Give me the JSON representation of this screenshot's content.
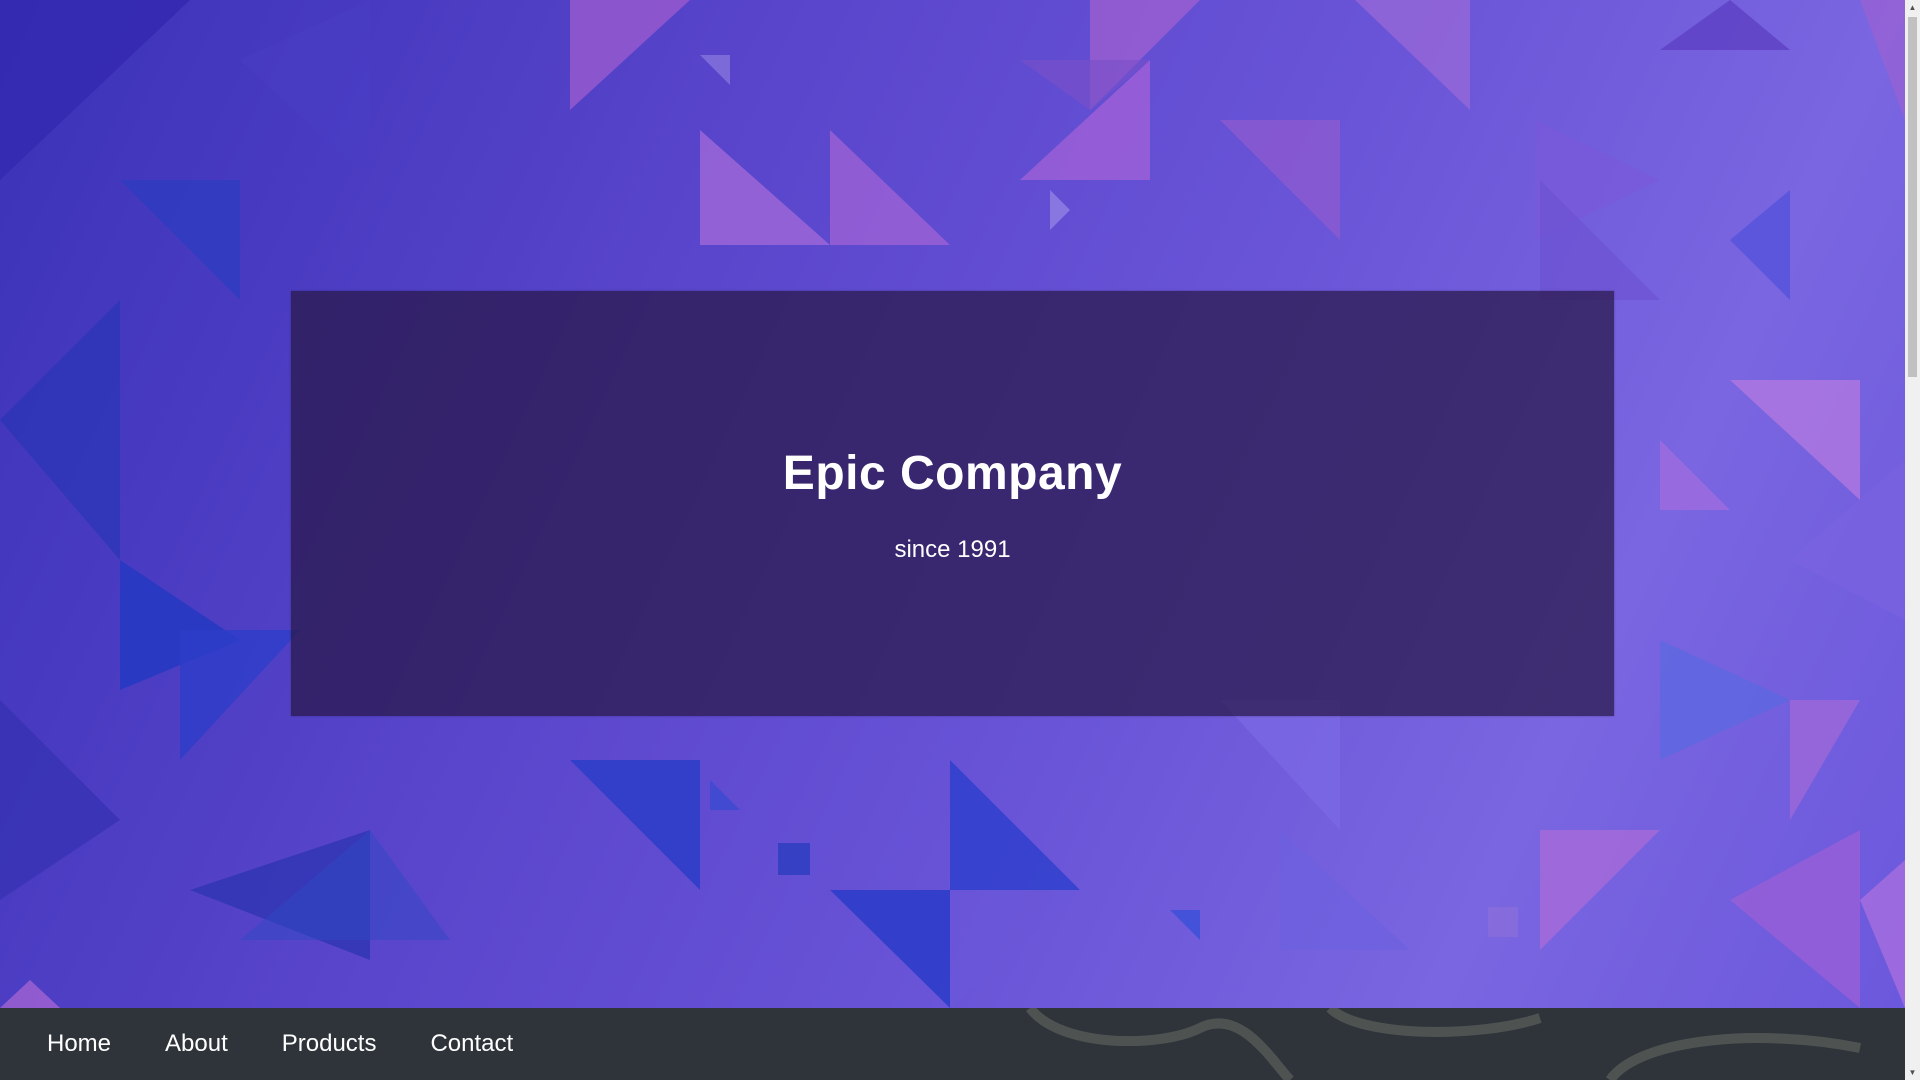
{
  "hero": {
    "title": "Epic Company",
    "subtitle": "since 1991",
    "background_icon": "geometric-triangle-pattern"
  },
  "nav": {
    "items": [
      {
        "label": "Home"
      },
      {
        "label": "About"
      },
      {
        "label": "Products"
      },
      {
        "label": "Contact"
      }
    ]
  },
  "colors": {
    "hero_base": "#5a46cc",
    "banner_overlay": "#281848",
    "navbar_bg": "#2f343a",
    "text": "#ffffff"
  },
  "scrollbar": {
    "up_icon": "chevron-up-icon",
    "down_icon": "chevron-down-icon"
  }
}
